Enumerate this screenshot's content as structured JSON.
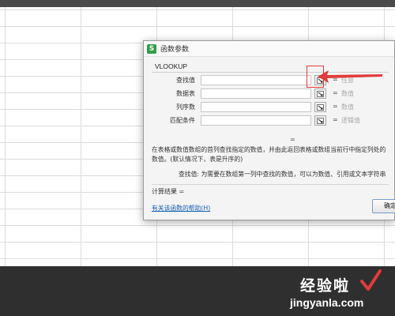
{
  "dialog": {
    "title": "函数参数",
    "app_icon_letter": "S",
    "function_name": "VLOOKUP",
    "params": [
      {
        "label": "查找值",
        "eq": "=",
        "type": "任意"
      },
      {
        "label": "数据表",
        "eq": "=",
        "type": "数值"
      },
      {
        "label": "列序数",
        "eq": "=",
        "type": "数值"
      },
      {
        "label": "匹配条件",
        "eq": "=",
        "type": "逻辑值"
      }
    ],
    "result_eq": "=",
    "description": "在表格或数值数组的首列查找指定的数值，并由此返回表格或数组当前行中指定列处的数值。(默认情况下，表是升序的)",
    "arg_help": "查找值:  为需要在数组第一列中查找的数值，可以为数值、引用或文本字符串",
    "calc_result": "计算结果 =",
    "help_link": "有关该函数的帮助(H)",
    "ok_label": "确定"
  },
  "watermark": {
    "title": "经验啦",
    "url": "jingyanla.com"
  },
  "colors": {
    "highlight": "#e23b3b",
    "link": "#1a5fb4",
    "app_icon": "#2e9e47"
  }
}
